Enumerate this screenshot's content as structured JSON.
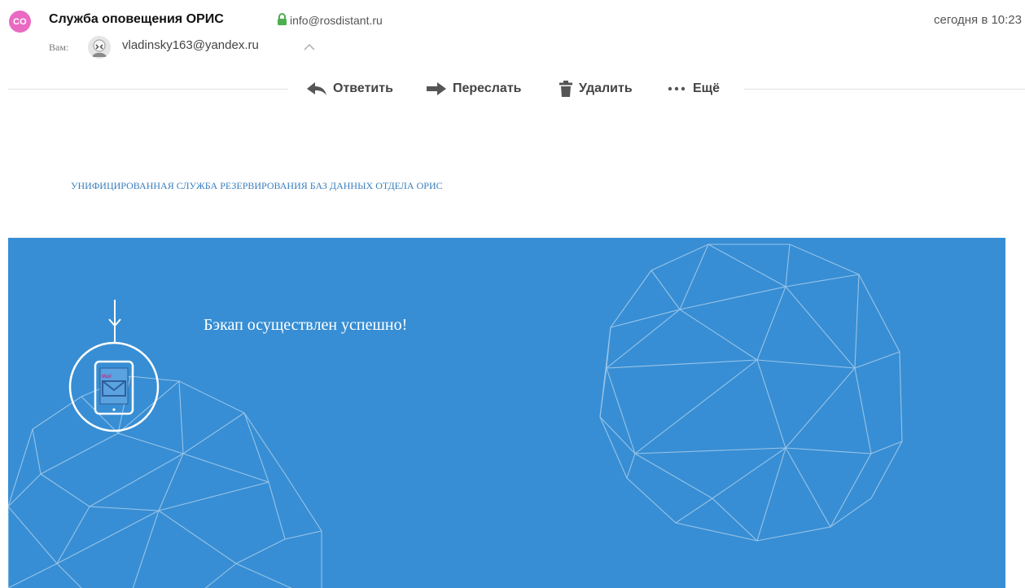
{
  "header": {
    "sender_initials": "CO",
    "sender_name": "Служба оповещения ОРИС",
    "sender_email": "info@rosdistant.ru",
    "date": "сегодня в 10:23",
    "to_label": "Вам:",
    "recipient_email": "vladinsky163@yandex.ru"
  },
  "toolbar": {
    "reply_label": "Ответить",
    "forward_label": "Переслать",
    "delete_label": "Удалить",
    "more_label": "Ещё"
  },
  "body": {
    "service_title": "УНИФИЦИРОВАННАЯ СЛУЖБА РЕЗЕРВИРОВАНИЯ БАЗ ДАННЫХ ОТДЕЛА ОРИС",
    "message": "Бэкап осуществлен успешно!",
    "tablet_screen_text": "Mail"
  },
  "colors": {
    "avatar_accent": "#e96ac2",
    "lock_green": "#4caf50",
    "banner_blue": "#378ed4",
    "title_blue": "#3a7fbf"
  },
  "icons": {
    "lock": "lock-icon",
    "collapse": "chevron-up-icon",
    "reply": "reply-arrow-icon",
    "forward": "forward-arrow-icon",
    "delete": "trash-icon",
    "more": "more-dots-icon",
    "tablet": "tablet-mail-icon"
  }
}
